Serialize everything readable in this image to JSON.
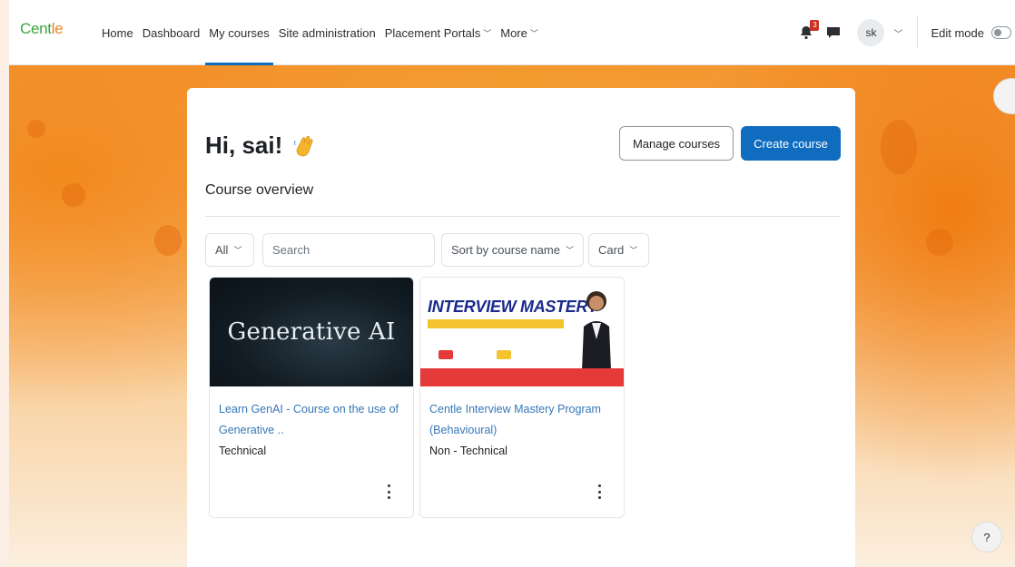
{
  "brand": {
    "logo_text": "Centle",
    "logo_prefix": "Cent",
    "logo_accent": "le"
  },
  "nav": {
    "items": [
      {
        "label": "Home",
        "has_caret": false,
        "active": false
      },
      {
        "label": "Dashboard",
        "has_caret": false,
        "active": false
      },
      {
        "label": "My courses",
        "has_caret": false,
        "active": true
      },
      {
        "label": "Site administration",
        "has_caret": false,
        "active": false
      },
      {
        "label": "Placement Portals",
        "has_caret": true,
        "active": false
      },
      {
        "label": "More",
        "has_caret": true,
        "active": false
      }
    ],
    "notification_count": "3",
    "user_initials": "sk",
    "edit_mode_label": "Edit mode"
  },
  "page": {
    "greeting": "Hi, sai!",
    "manage_courses_label": "Manage courses",
    "create_course_label": "Create course",
    "overview_title": "Course overview"
  },
  "filters": {
    "grouping": "All",
    "search_placeholder": "Search",
    "sort": "Sort by course name",
    "view": "Card"
  },
  "courses": [
    {
      "image_title": "Generative AI",
      "name": "Learn GenAI - Course on the use of Generative ..",
      "category": "Technical"
    },
    {
      "image_title": "INTERVIEW MASTERY",
      "name": "Centle Interview Mastery Program (Behavioural)",
      "category": "Non - Technical"
    }
  ],
  "help_label": "?",
  "colors": {
    "primary": "#0f6cbf",
    "link": "#3577b8",
    "accent": "#f08a1e",
    "badge": "#ca3120"
  }
}
